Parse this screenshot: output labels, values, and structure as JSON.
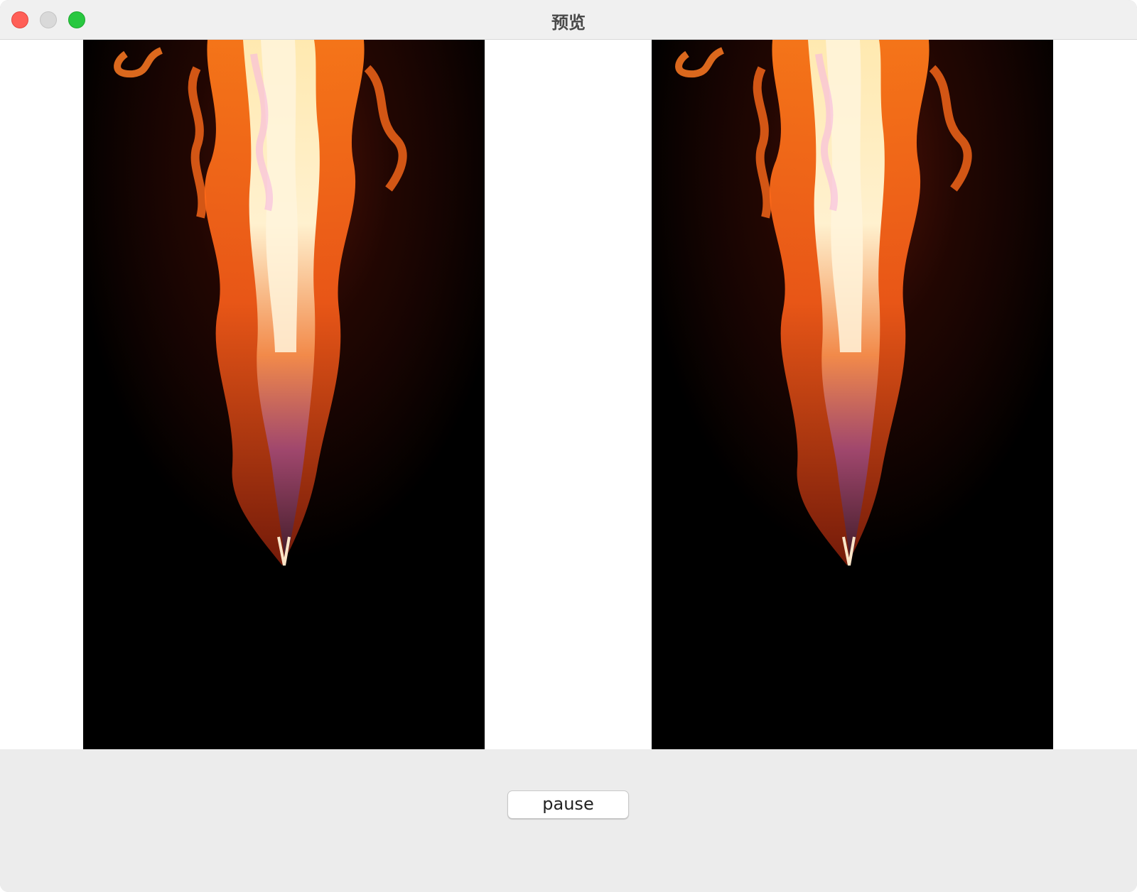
{
  "window": {
    "title": "预览"
  },
  "preview": {
    "panes": [
      {
        "content": "fire-flame-frame"
      },
      {
        "content": "fire-flame-frame"
      }
    ]
  },
  "controls": {
    "pause_label": "pause"
  },
  "colors": {
    "close": "#ff5f57",
    "minimize": "#d9d9d9",
    "zoom": "#28c840",
    "video_background": "#000000",
    "panel_background": "#ececec"
  }
}
